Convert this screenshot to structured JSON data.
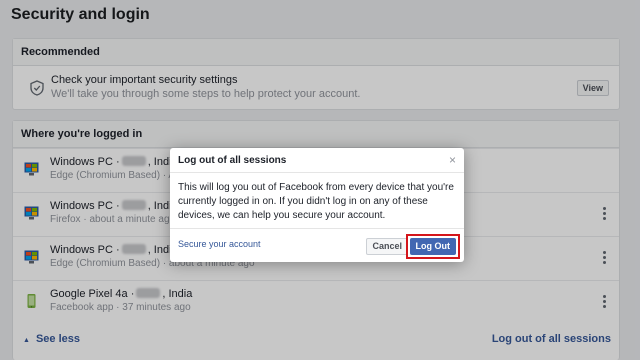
{
  "page_title": "Security and login",
  "recommended": {
    "header": "Recommended",
    "title": "Check your important security settings",
    "subtitle": "We'll take you through some steps to help protect your account.",
    "view_label": "View",
    "icon": "shield-icon"
  },
  "sessions": {
    "header": "Where you're logged in",
    "items": [
      {
        "device": "Windows PC ·",
        "location": ", India",
        "detail": "Edge (Chromium Based) · A",
        "icon": "monitor-icon"
      },
      {
        "device": "Windows PC ·",
        "location": ", India",
        "detail": "Firefox · about a minute ag",
        "icon": "monitor-icon"
      },
      {
        "device": "Windows PC ·",
        "location": ", India",
        "detail": "Edge (Chromium Based) · about a minute ago",
        "icon": "monitor-icon"
      },
      {
        "device": "Google Pixel 4a ·",
        "location": ", India",
        "detail": "Facebook app · 37 minutes ago",
        "icon": "phone-icon"
      }
    ],
    "see_less": "See less",
    "logout_all": "Log out of all sessions"
  },
  "dialog": {
    "title": "Log out of all sessions",
    "close": "×",
    "body": "This will log you out of Facebook from every device that you're currently logged in on. If you didn't log in on any of these devices, we can help you secure your account.",
    "secure_link": "Secure your account",
    "cancel_label": "Cancel",
    "logout_label": "Log Out"
  },
  "colors": {
    "accent": "#4267b2",
    "link": "#365899",
    "highlight": "#d4151b"
  }
}
